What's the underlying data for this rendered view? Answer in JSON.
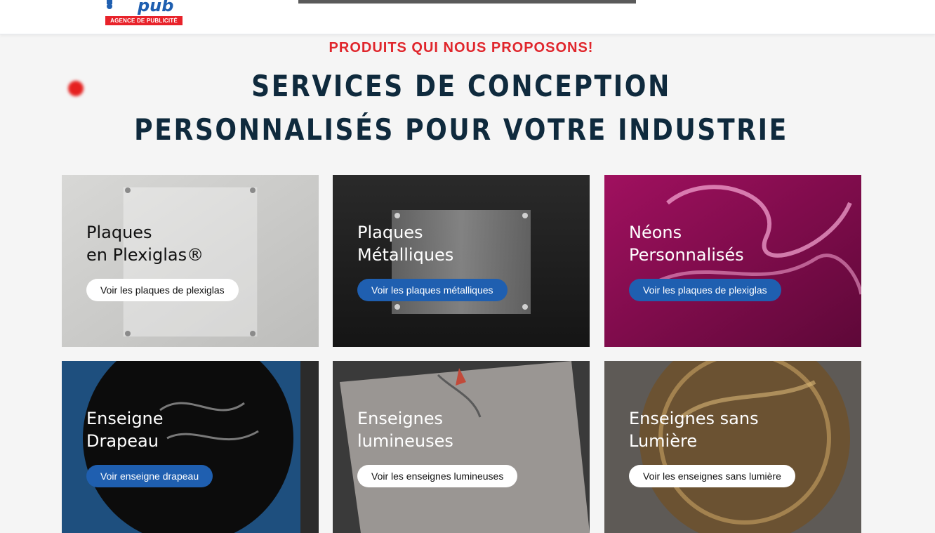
{
  "header": {
    "logo_text": "pub",
    "logo_tagline": "AGENCE DE PUBLICITÉ"
  },
  "section": {
    "eyebrow": "PRODUITS QUI NOUS PROPOSONS!",
    "title_line1": "SERVICES DE CONCEPTION",
    "title_line2": "PERSONNALISÉS POUR VOTRE INDUSTRIE"
  },
  "cards": [
    {
      "title": "Plaques\nen Plexiglas®",
      "button": "Voir les plaques de plexiglas"
    },
    {
      "title": "Plaques\nMétalliques",
      "button": "Voir les plaques métalliques"
    },
    {
      "title": "Néons\nPersonnalisés",
      "button": "Voir les plaques de plexiglas"
    },
    {
      "title": "Enseigne\nDrapeau",
      "button": "Voir enseigne drapeau"
    },
    {
      "title": "Enseignes\nlumineuses",
      "button": "Voir les enseignes lumineuses"
    },
    {
      "title": "Enseignes sans\nLumière",
      "button": "Voir les enseignes sans lumière"
    }
  ],
  "colors": {
    "accent_red": "#e0262c",
    "title_navy": "#0f2a3d",
    "button_blue": "#1f5fb0",
    "background": "#f5f5f5"
  }
}
